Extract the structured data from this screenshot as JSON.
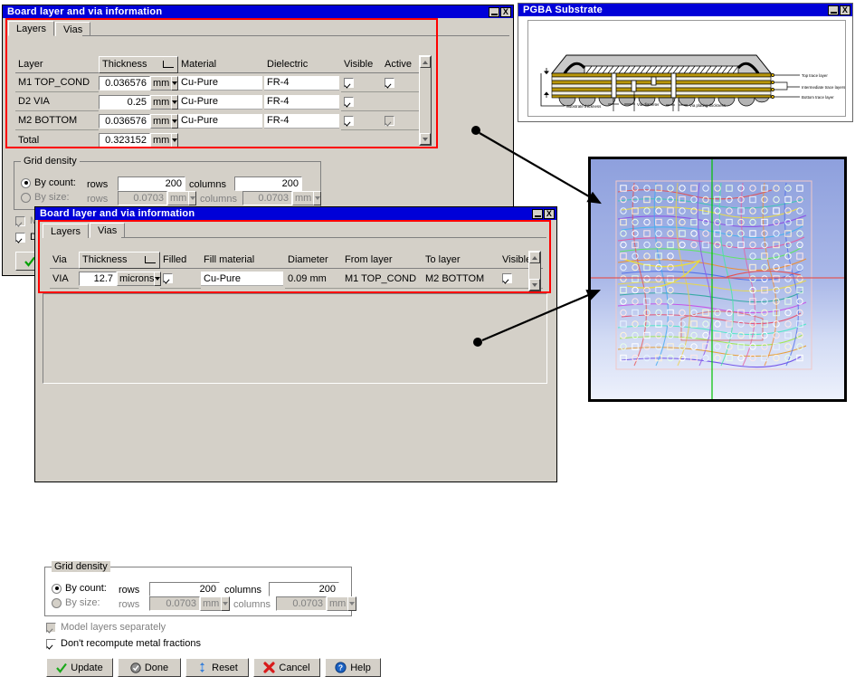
{
  "dialog1": {
    "title": "Board layer and via information",
    "window_buttons": {
      "minimize": "_",
      "close": "X"
    },
    "tabs": [
      {
        "label": "Layers",
        "selected": true
      },
      {
        "label": "Vias",
        "selected": false
      }
    ],
    "layers_table": {
      "headers": [
        "Layer",
        "Thickness",
        "Material",
        "Dielectric",
        "Visible",
        "Active"
      ],
      "rows": [
        {
          "layer": "M1 TOP_COND",
          "thickness": "0.036576",
          "unit": "mm",
          "material": "Cu-Pure",
          "dielectric": "FR-4",
          "visible": true,
          "active": true,
          "active_disabled": false
        },
        {
          "layer": "D2 VIA",
          "thickness": "0.25",
          "unit": "mm",
          "material": "Cu-Pure",
          "dielectric": "FR-4",
          "visible": true,
          "active": false,
          "active_disabled": false
        },
        {
          "layer": "M2 BOTTOM",
          "thickness": "0.036576",
          "unit": "mm",
          "material": "Cu-Pure",
          "dielectric": "FR-4",
          "visible": true,
          "active": true,
          "active_disabled": true
        }
      ],
      "total_label": "Total",
      "total_value": "0.323152",
      "total_unit": "mm"
    },
    "grid_density": {
      "legend": "Grid density",
      "by_count_label": "By count:",
      "by_size_label": "By size:",
      "rows_label": "rows",
      "columns_label": "columns",
      "by_count_selected": true,
      "by_size_selected": false,
      "count_rows_value": "200",
      "count_columns_value": "200",
      "size_rows_value": "0.0703",
      "size_columns_value": "0.0703",
      "size_rows_unit": "mm",
      "size_columns_unit": "mm"
    },
    "checkboxes": [
      {
        "label": "Model layers separately",
        "checked": true,
        "disabled": true
      },
      {
        "label": "Don't recompute metal fractions",
        "checked": true,
        "disabled": false
      }
    ],
    "buttons": [
      {
        "label": "Update",
        "icon": "check-icon"
      },
      {
        "label": "Done",
        "icon": "done-icon"
      },
      {
        "label": "Reset",
        "icon": "reset-icon"
      },
      {
        "label": "Cancel",
        "icon": "cancel-icon"
      },
      {
        "label": "Help",
        "icon": "help-icon"
      }
    ]
  },
  "dialog2": {
    "title": "Board layer and via information",
    "window_buttons": {
      "minimize": "_",
      "close": "X"
    },
    "tabs": [
      {
        "label": "Layers",
        "selected": false
      },
      {
        "label": "Vias",
        "selected": true
      }
    ],
    "vias_table": {
      "headers": [
        "Via",
        "Thickness",
        "Filled",
        "Fill material",
        "Diameter",
        "From layer",
        "To layer",
        "Visible"
      ],
      "rows": [
        {
          "via": "VIA",
          "thickness": "12.7",
          "unit": "microns",
          "filled": true,
          "fill_material": "Cu-Pure",
          "diameter": "0.09 mm",
          "from_layer": "M1 TOP_COND",
          "to_layer": "M2 BOTTOM",
          "visible": true
        }
      ]
    },
    "grid_density": {
      "legend": "Grid density",
      "by_count_label": "By count:",
      "by_size_label": "By size:",
      "rows_label": "rows",
      "columns_label": "columns",
      "by_count_selected": true,
      "by_size_selected": false,
      "count_rows_value": "200",
      "count_columns_value": "200",
      "size_rows_value": "0.0703",
      "size_columns_value": "0.0703",
      "size_rows_unit": "mm",
      "size_columns_unit": "mm"
    },
    "checkboxes": [
      {
        "label": "Model layers separately",
        "checked": true,
        "disabled": true
      },
      {
        "label": "Don't recompute metal fractions",
        "checked": true,
        "disabled": false
      }
    ],
    "buttons": [
      {
        "label": "Update",
        "icon": "check-icon"
      },
      {
        "label": "Done",
        "icon": "done-icon"
      },
      {
        "label": "Reset",
        "icon": "reset-icon"
      },
      {
        "label": "Cancel",
        "icon": "cancel-icon"
      },
      {
        "label": "Help",
        "icon": "help-icon"
      }
    ]
  },
  "substrate_window": {
    "title": "PGBA Substrate",
    "window_buttons": {
      "minimize": "_",
      "close": "X"
    },
    "annotations": {
      "top_trace": "Top trace layer",
      "intermediate_trace": "Intermediate trace layers",
      "bottom_trace": "Bottom trace layer",
      "substrate_thickness": "Substrate thickness",
      "via_diameter": "Via diameter",
      "via_plating_thickness": "Via plating thickness"
    }
  },
  "pcb_view": {
    "name": "pcb-layout-preview",
    "crosshair_vertical_color": "#00c000",
    "crosshair_horizontal_color": "#e04040"
  },
  "colors": {
    "title_bar": "#0000d8",
    "dialog_face": "#d4d0c8",
    "highlight_outline": "#ff0000",
    "field_bg": "#ffffff",
    "disabled_text": "#808080"
  }
}
